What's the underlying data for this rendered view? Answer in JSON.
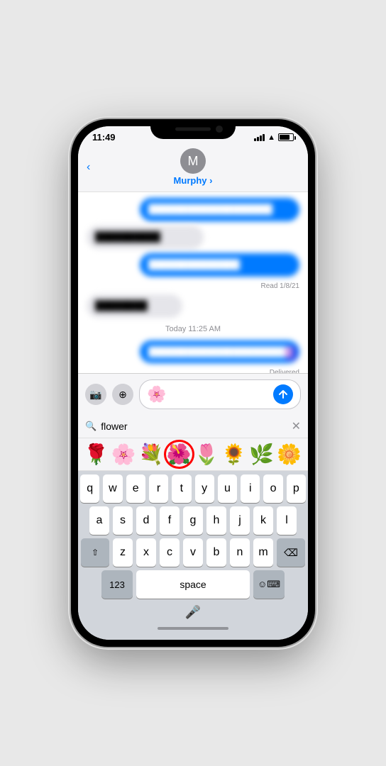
{
  "statusBar": {
    "time": "11:49",
    "batteryLabel": "battery"
  },
  "header": {
    "backLabel": "‹",
    "avatarLetter": "M",
    "contactName": "Murphy"
  },
  "messages": [
    {
      "id": 1,
      "type": "sent",
      "blurred": true,
      "text": "Blurred sent message here"
    },
    {
      "id": 2,
      "type": "received",
      "blurred": true,
      "text": "Blurred received message"
    },
    {
      "id": 3,
      "type": "sent",
      "blurred": true,
      "text": "Blurred sent message two"
    },
    {
      "id": 4,
      "meta": "Read 1/8/21"
    },
    {
      "id": 5,
      "type": "received",
      "blurred": true,
      "text": "Blurred received two"
    },
    {
      "id": 6,
      "meta": "Today 11:25 AM",
      "metaCenter": true
    },
    {
      "id": 7,
      "type": "sent",
      "blurred": true,
      "text": "Blurred sent message three long"
    },
    {
      "id": 8,
      "meta": "Delivered",
      "right": true
    }
  ],
  "inputArea": {
    "cameraIconLabel": "📷",
    "appsIconLabel": "⊕",
    "inputEmoji": "🌸",
    "sendLabel": "↑"
  },
  "emojiSearch": {
    "placeholder": "flower",
    "searchValue": "flower",
    "clearLabel": "✕"
  },
  "emojiResults": [
    {
      "id": 1,
      "emoji": "🌹",
      "highlighted": false
    },
    {
      "id": 2,
      "emoji": "🌸",
      "highlighted": false
    },
    {
      "id": 3,
      "emoji": "💐",
      "highlighted": false
    },
    {
      "id": 4,
      "emoji": "🌺",
      "highlighted": true
    },
    {
      "id": 5,
      "emoji": "🌷",
      "highlighted": false
    },
    {
      "id": 6,
      "emoji": "🌻",
      "highlighted": false
    },
    {
      "id": 7,
      "emoji": "🌿",
      "highlighted": false
    },
    {
      "id": 8,
      "emoji": "🌼",
      "highlighted": false
    }
  ],
  "keyboard": {
    "rows": [
      [
        "q",
        "w",
        "e",
        "r",
        "t",
        "y",
        "u",
        "i",
        "o",
        "p"
      ],
      [
        "a",
        "s",
        "d",
        "f",
        "g",
        "h",
        "j",
        "k",
        "l"
      ],
      [
        "⇧",
        "z",
        "x",
        "c",
        "v",
        "b",
        "n",
        "m",
        "⌫"
      ],
      [
        "123",
        "space",
        "☺"
      ]
    ],
    "spaceLabel": "space",
    "numLabel": "123",
    "emojiLabel": "☺⌨"
  }
}
